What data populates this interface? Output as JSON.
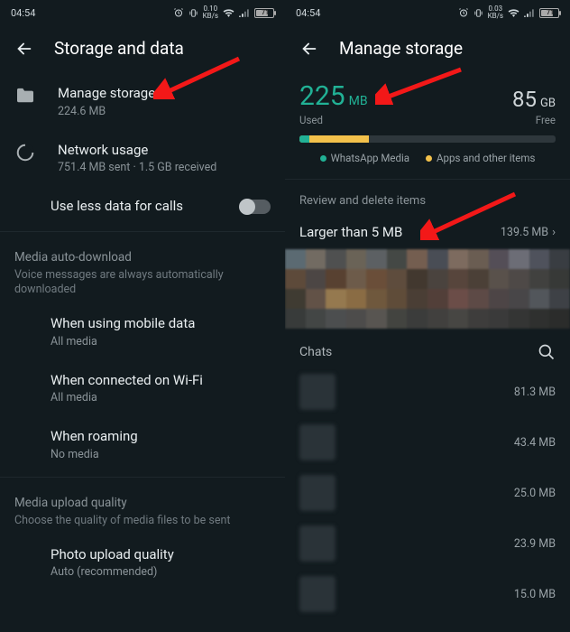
{
  "status": {
    "time": "04:54",
    "speed_left": "0.10",
    "speed_unit": "KB/s",
    "speed_right": "0.03",
    "battery": "71"
  },
  "left": {
    "title": "Storage and data",
    "manage_storage": {
      "title": "Manage storage",
      "sub": "224.6 MB"
    },
    "network_usage": {
      "title": "Network usage",
      "sub": "751.4 MB sent · 1.5 GB received"
    },
    "use_less": {
      "title": "Use less data for calls"
    },
    "media_auto_head": "Media auto-download",
    "media_auto_desc": "Voice messages are always automatically downloaded",
    "mobile": {
      "title": "When using mobile data",
      "sub": "All media"
    },
    "wifi": {
      "title": "When connected on Wi-Fi",
      "sub": "All media"
    },
    "roaming": {
      "title": "When roaming",
      "sub": "No media"
    },
    "upload_head": "Media upload quality",
    "upload_desc": "Choose the quality of media files to be sent",
    "photo_quality": {
      "title": "Photo upload quality",
      "sub": "Auto (recommended)"
    }
  },
  "right": {
    "title": "Manage storage",
    "used_num": "225",
    "used_unit": "MB",
    "used_label": "Used",
    "free_num": "85",
    "free_unit": "GB",
    "free_label": "Free",
    "legend1": "WhatsApp Media",
    "legend2": "Apps and other items",
    "review_head": "Review and delete items",
    "larger": {
      "label": "Larger than 5 MB",
      "size": "139.5 MB"
    },
    "chats_label": "Chats",
    "chats": [
      {
        "size": "81.3 MB"
      },
      {
        "size": "43.4 MB"
      },
      {
        "size": "25.0 MB"
      },
      {
        "size": "23.9 MB"
      },
      {
        "size": "15.0 MB"
      }
    ]
  },
  "thumb_colors": [
    "#5b6a72",
    "#726b62",
    "#4f5050",
    "#6a6357",
    "#5c6063",
    "#444845",
    "#745e50",
    "#494d55",
    "#7d6b5f",
    "#6a5d52",
    "#544e57",
    "#6c6d76",
    "#4f525c",
    "#393d42",
    "#5d4a3a",
    "#4c4644",
    "#584131",
    "#6d5b4a",
    "#6a4e39",
    "#5e4c3d",
    "#42382f",
    "#4a433e",
    "#57453c",
    "#4b4037",
    "#59514b",
    "#4e4947",
    "#41413f",
    "#373937",
    "#3f3b32",
    "#625247",
    "#95794f",
    "#8a6c44",
    "#6f583d",
    "#5f4c39",
    "#4a3e35",
    "#523f39",
    "#6b4d48",
    "#5d4a46",
    "#4d4546",
    "#484648",
    "#52565b",
    "#3e4146",
    "#383b3a",
    "#434645",
    "#4c4e4f",
    "#4d4c4b",
    "#585551",
    "#434440",
    "#3b3c3b",
    "#41403e",
    "#474643",
    "#3e3d3c",
    "#3a3a3a",
    "#343534",
    "#2f302f",
    "#2b2c2b"
  ]
}
